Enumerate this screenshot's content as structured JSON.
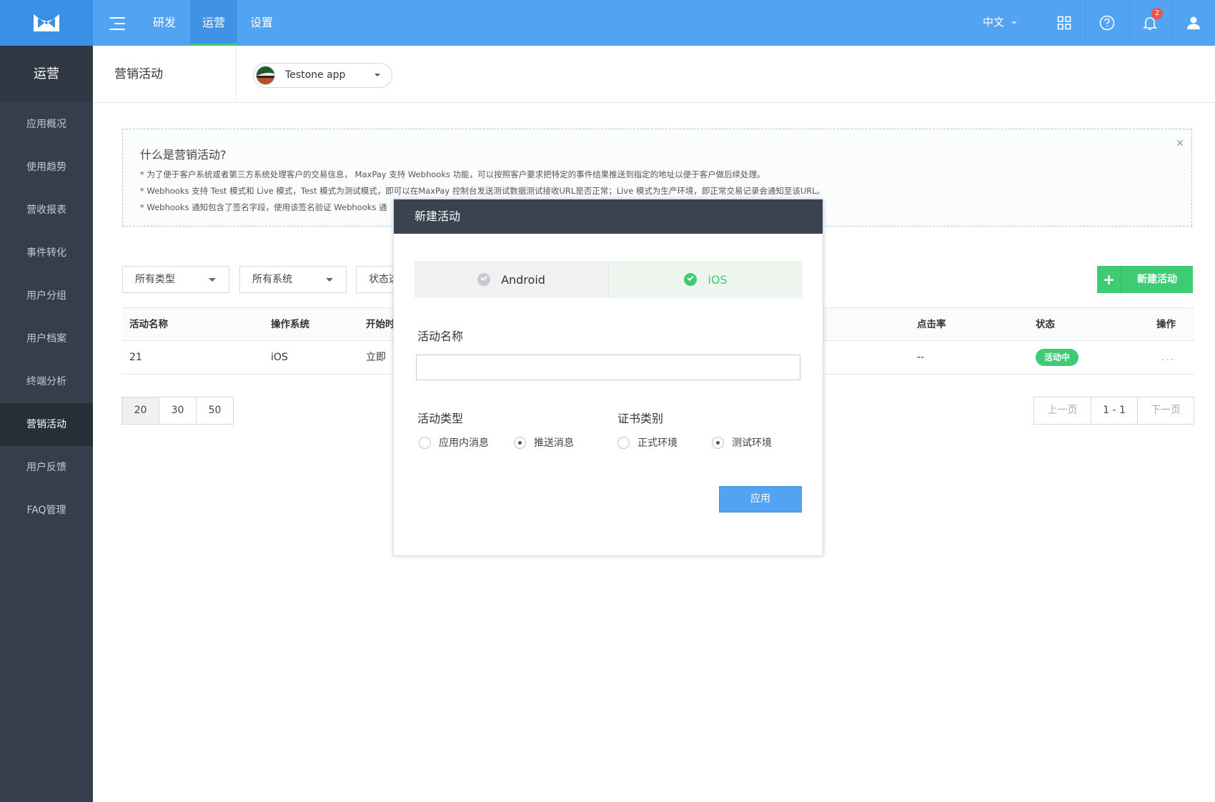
{
  "topbar": {
    "nav": [
      {
        "label": "研发"
      },
      {
        "label": "运营"
      },
      {
        "label": "设置"
      }
    ],
    "language": "中文",
    "notification_count": "2"
  },
  "sidebar": {
    "title": "运营",
    "items": [
      {
        "label": "应用概况"
      },
      {
        "label": "使用趋势"
      },
      {
        "label": "营收报表"
      },
      {
        "label": "事件转化"
      },
      {
        "label": "用户分组"
      },
      {
        "label": "用户档案"
      },
      {
        "label": "终端分析"
      },
      {
        "label": "营销活动"
      },
      {
        "label": "用户反馈"
      },
      {
        "label": "FAQ管理"
      }
    ]
  },
  "header": {
    "title": "营销活动",
    "app_name": "Testone app"
  },
  "info": {
    "title": "什么是营销活动?",
    "lines": [
      "*  为了便于客户系统或者第三方系统处理客户的交易信息， MaxPay 支持 Webhooks 功能，可以按照客户要求把特定的事件结果推送到指定的地址以便于客户做后续处理。",
      "*  Webhooks 支持 Test 模式和 Live 模式，Test 模式为测试模式，即可以在MaxPay 控制台发送测试数据测试接收URL是否正常；Live 模式为生产环境，即正常交易记录会通知至该URL。",
      "*  Webhooks 通知包含了签名字段，使用该签名验证 Webhooks 通"
    ]
  },
  "filters": {
    "type": "所有类型",
    "system": "所有系统",
    "status": "状态选"
  },
  "new_button": {
    "plus": "+",
    "label": "新建活动"
  },
  "table": {
    "headers": {
      "name": "活动名称",
      "os": "操作系统",
      "start": "开始时",
      "ctr": "点击率",
      "status": "状态",
      "actions": "操作"
    },
    "rows": [
      {
        "name": "21",
        "os": "iOS",
        "start": "立即",
        "ctr": "--",
        "status": "活动中",
        "actions": "..."
      }
    ]
  },
  "page_sizes": [
    "20",
    "30",
    "50"
  ],
  "pager": {
    "prev": "上一页",
    "current": "1 - 1",
    "next": "下一页"
  },
  "modal": {
    "title": "新建活动",
    "os_tabs": {
      "android": "Android",
      "ios": "iOS"
    },
    "name_label": "活动名称",
    "name_value": "",
    "type_label": "活动类型",
    "type_options": {
      "in_app": "应用内消息",
      "push": "推送消息"
    },
    "cert_label": "证书类别",
    "cert_options": {
      "production": "正式环境",
      "test": "测试环境"
    },
    "apply_label": "应用"
  },
  "colors": {
    "topbar": "#52a3f1",
    "sidebar": "#353f4b",
    "accent_green": "#3ecb74",
    "modal_header": "#394450"
  }
}
